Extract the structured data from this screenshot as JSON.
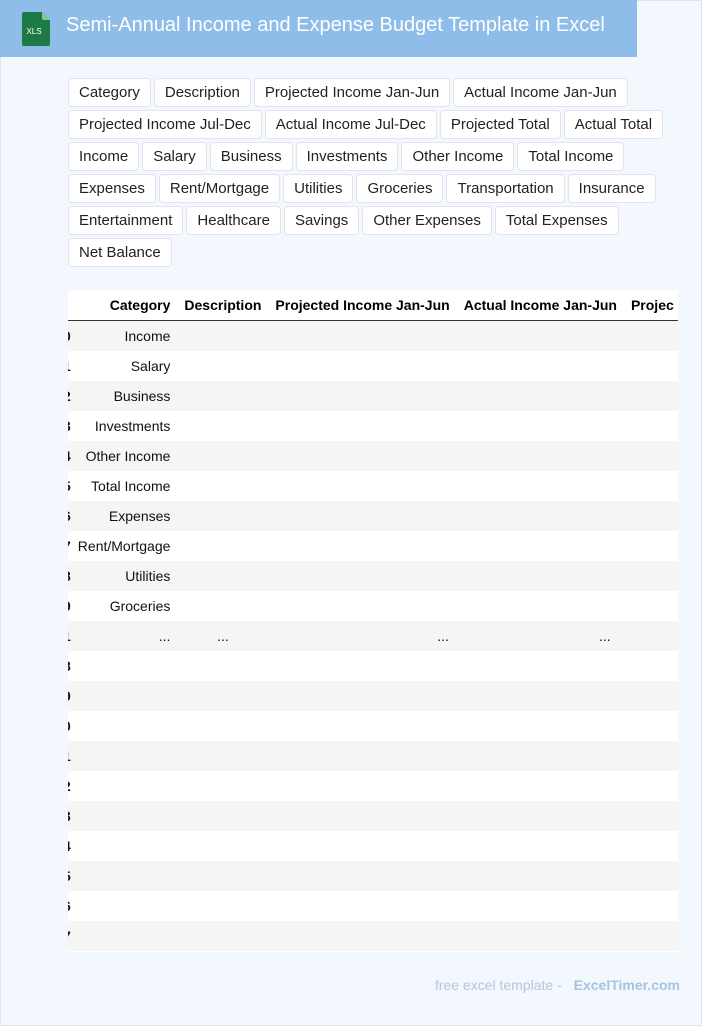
{
  "header": {
    "title": "Semi-Annual Income and Expense Budget Template in Excel",
    "icon_label": "XLS",
    "icon_color": "#1e7a45",
    "background": "#8fbde9"
  },
  "tags": [
    "Category",
    "Description",
    "Projected Income Jan-Jun",
    "Actual Income Jan-Jun",
    "Projected Income Jul-Dec",
    "Actual Income Jul-Dec",
    "Projected Total",
    "Actual Total",
    "Income",
    "Salary",
    "Business",
    "Investments",
    "Other Income",
    "Total Income",
    "Expenses",
    "Rent/Mortgage",
    "Utilities",
    "Groceries",
    "Transportation",
    "Insurance",
    "Entertainment",
    "Healthcare",
    "Savings",
    "Other Expenses",
    "Total Expenses",
    "Net Balance"
  ],
  "table": {
    "columns": [
      "Category",
      "Description",
      "Projected Income Jan-Jun",
      "Actual Income Jan-Jun",
      "Projec"
    ],
    "rows": [
      {
        "idx": "0",
        "cells": [
          "Income",
          "",
          "",
          "",
          ""
        ]
      },
      {
        "idx": "1",
        "cells": [
          "Salary",
          "",
          "",
          "",
          ""
        ]
      },
      {
        "idx": "2",
        "cells": [
          "Business",
          "",
          "",
          "",
          ""
        ]
      },
      {
        "idx": "3",
        "cells": [
          "Investments",
          "",
          "",
          "",
          ""
        ]
      },
      {
        "idx": "4",
        "cells": [
          "Other Income",
          "",
          "",
          "",
          ""
        ]
      },
      {
        "idx": "5",
        "cells": [
          "Total Income",
          "",
          "",
          "",
          ""
        ]
      },
      {
        "idx": "6",
        "cells": [
          "Expenses",
          "",
          "",
          "",
          ""
        ]
      },
      {
        "idx": "7",
        "cells": [
          "Rent/Mortgage",
          "",
          "",
          "",
          ""
        ]
      },
      {
        "idx": "8",
        "cells": [
          "Utilities",
          "",
          "",
          "",
          ""
        ]
      },
      {
        "idx": "9",
        "cells": [
          "Groceries",
          "",
          "",
          "",
          ""
        ]
      },
      {
        "idx": "1",
        "cells": [
          "...",
          "...",
          "...",
          "...",
          ""
        ]
      },
      {
        "idx": "8",
        "cells": [
          "",
          "",
          "",
          "",
          ""
        ]
      },
      {
        "idx": "9",
        "cells": [
          "",
          "",
          "",
          "",
          ""
        ]
      },
      {
        "idx": "0",
        "cells": [
          "",
          "",
          "",
          "",
          ""
        ]
      },
      {
        "idx": "1",
        "cells": [
          "",
          "",
          "",
          "",
          ""
        ]
      },
      {
        "idx": "2",
        "cells": [
          "",
          "",
          "",
          "",
          ""
        ]
      },
      {
        "idx": "3",
        "cells": [
          "",
          "",
          "",
          "",
          ""
        ]
      },
      {
        "idx": "4",
        "cells": [
          "",
          "",
          "",
          "",
          ""
        ]
      },
      {
        "idx": "5",
        "cells": [
          "",
          "",
          "",
          "",
          ""
        ]
      },
      {
        "idx": "6",
        "cells": [
          "",
          "",
          "",
          "",
          ""
        ]
      },
      {
        "idx": "7",
        "cells": [
          "",
          "",
          "",
          "",
          ""
        ]
      }
    ]
  },
  "footer": {
    "prefix": "free excel template -",
    "brand": "ExcelTimer.com"
  }
}
